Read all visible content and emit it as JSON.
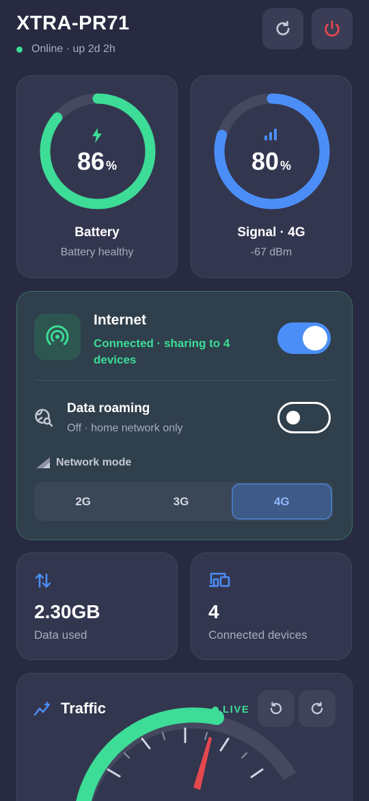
{
  "header": {
    "device_name": "XTRA-PR71",
    "status_text": "Online · up 2d 2h"
  },
  "battery": {
    "value": "86",
    "unit": "%",
    "level": 86,
    "label": "Battery",
    "sub": "Battery healthy",
    "color": "#3ddc97"
  },
  "signal": {
    "value": "80",
    "unit": "%",
    "level": 80,
    "label": "Signal · 4G",
    "sub": "-67 dBm",
    "color": "#4b8ef7"
  },
  "internet": {
    "title": "Internet",
    "status": "Connected · sharing to 4 devices",
    "enabled": true
  },
  "roaming": {
    "title": "Data roaming",
    "sub": "Off · home network only",
    "enabled": false
  },
  "network_mode": {
    "label": "Network mode",
    "options": [
      "2G",
      "3G",
      "4G"
    ],
    "selected": "4G"
  },
  "stats": {
    "data_used_value": "2.30GB",
    "data_used_label": "Data used",
    "devices_value": "4",
    "devices_label": "Connected devices"
  },
  "traffic": {
    "title": "Traffic",
    "live_label": "LIVE"
  },
  "colors": {
    "accent_green": "#3ddc97",
    "accent_blue": "#4b8ef7",
    "danger_red": "#e5484d",
    "background": "#272a40"
  }
}
